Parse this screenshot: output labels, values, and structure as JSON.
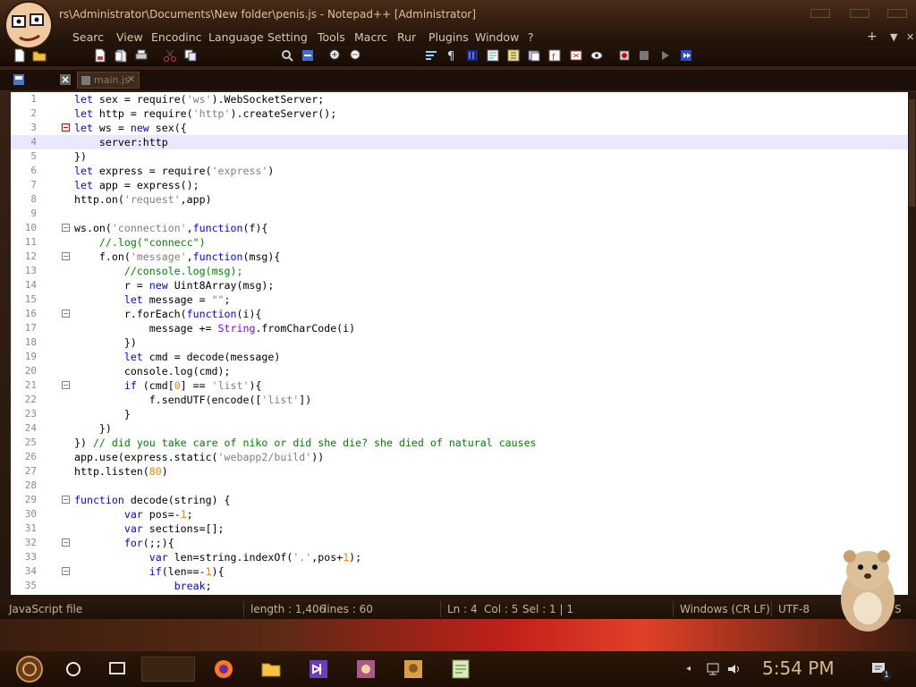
{
  "window": {
    "title": "rs\\Administrator\\Documents\\New folder\\penis.js - Notepad++ [Administrator]"
  },
  "menu": {
    "items": [
      "Searc",
      "View",
      "Encodinc",
      "Language",
      "Setting",
      "Tools",
      "Macrc",
      "Rur",
      "Plugins",
      "Window",
      "?"
    ],
    "right_plus": "+",
    "right_down": "▼",
    "right_close": "✕"
  },
  "tabs": {
    "active": "main.js"
  },
  "editor": {
    "current_line": 4,
    "lines": [
      {
        "n": "1",
        "code": "let sex = require('ws').WebSocketServer;"
      },
      {
        "n": "2",
        "code": "let http = require('http').createServer();"
      },
      {
        "n": "3",
        "code": "let ws = new sex({"
      },
      {
        "n": "4",
        "code": "    server:http"
      },
      {
        "n": "5",
        "code": "})"
      },
      {
        "n": "6",
        "code": "let express = require('express')"
      },
      {
        "n": "7",
        "code": "let app = express();"
      },
      {
        "n": "8",
        "code": "http.on('request',app)"
      },
      {
        "n": "9",
        "code": ""
      },
      {
        "n": "10",
        "code": "ws.on('connection',function(f){"
      },
      {
        "n": "11",
        "code": "    //.log(\"connecc\")"
      },
      {
        "n": "12",
        "code": "    f.on('message',function(msg){"
      },
      {
        "n": "13",
        "code": "        //console.log(msg);"
      },
      {
        "n": "14",
        "code": "        r = new Uint8Array(msg);"
      },
      {
        "n": "15",
        "code": "        let message = \"\";"
      },
      {
        "n": "16",
        "code": "        r.forEach(function(i){"
      },
      {
        "n": "17",
        "code": "            message += String.fromCharCode(i)"
      },
      {
        "n": "18",
        "code": "        })"
      },
      {
        "n": "19",
        "code": "        let cmd = decode(message)"
      },
      {
        "n": "20",
        "code": "        console.log(cmd);"
      },
      {
        "n": "21",
        "code": "        if (cmd[0] == 'list'){"
      },
      {
        "n": "22",
        "code": "            f.sendUTF(encode(['list'])"
      },
      {
        "n": "23",
        "code": "        }"
      },
      {
        "n": "24",
        "code": "    })"
      },
      {
        "n": "25",
        "code": "}) // did you take care of niko or did she die? she died of natural causes"
      },
      {
        "n": "26",
        "code": "app.use(express.static('webapp2/build'))"
      },
      {
        "n": "27",
        "code": "http.listen(80)"
      },
      {
        "n": "28",
        "code": ""
      },
      {
        "n": "29",
        "code": "function decode(string) {"
      },
      {
        "n": "30",
        "code": "        var pos=-1;"
      },
      {
        "n": "31",
        "code": "        var sections=[];"
      },
      {
        "n": "32",
        "code": "        for(;;){"
      },
      {
        "n": "33",
        "code": "            var len=string.indexOf('.',pos+1);"
      },
      {
        "n": "34",
        "code": "            if(len==-1){"
      },
      {
        "n": "35",
        "code": "                break;"
      }
    ]
  },
  "status": {
    "filetype": "JavaScript file",
    "length": "length : 1,406",
    "lines": "lines : 60",
    "ln": "Ln : 4",
    "col": "Col : 5",
    "sel": "Sel : 1 | 1",
    "eol": "Windows (CR LF)",
    "encoding": "UTF-8",
    "mode": "S"
  },
  "taskbar": {
    "clock": "5:54 PM",
    "notification_count": "1"
  },
  "colors": {
    "keyword": "#0000ff",
    "string": "#808080",
    "number": "#ff8000",
    "comment": "#008000",
    "type": "#8000ff"
  }
}
